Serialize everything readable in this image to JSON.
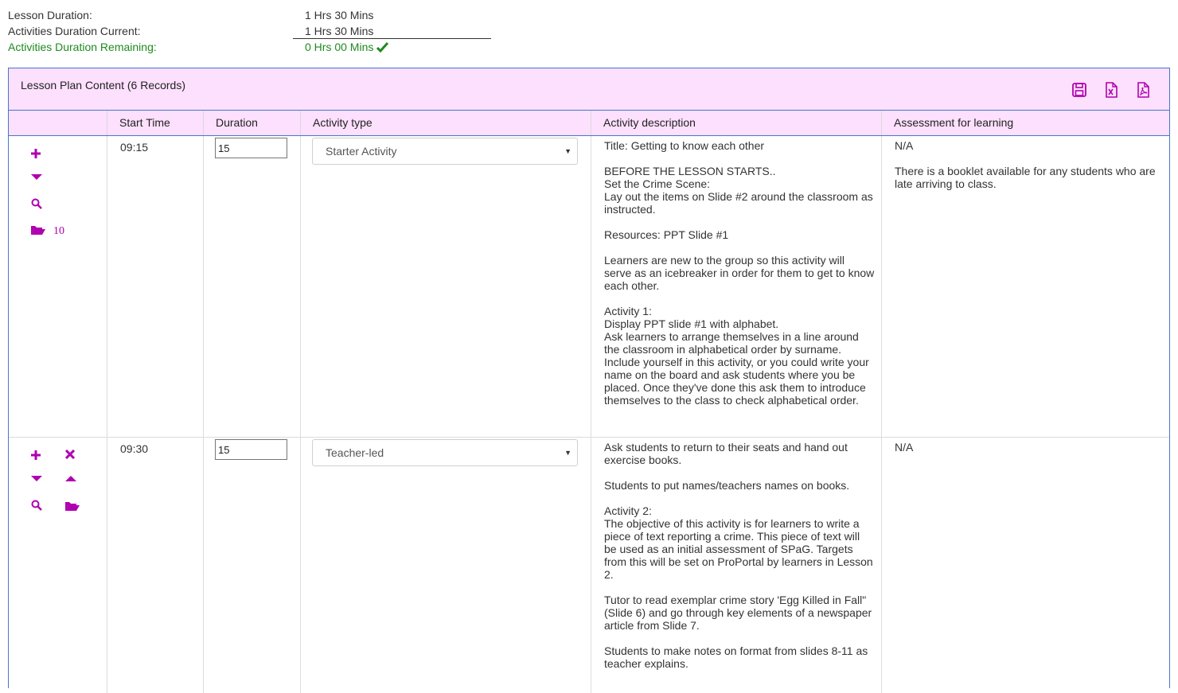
{
  "summary": {
    "lesson_duration_label": "Lesson Duration:",
    "lesson_duration_value": "1 Hrs 30 Mins",
    "current_label": "Activities Duration Current:",
    "current_value": "1 Hrs 30 Mins",
    "remaining_label": "Activities Duration Remaining:",
    "remaining_value": "0 Hrs 00 Mins"
  },
  "panel": {
    "title": "Lesson Plan Content (6 Records)"
  },
  "columns": [
    "Start Time",
    "Duration",
    "Activity type",
    "Activity description",
    "Assessment for learning"
  ],
  "rows": [
    {
      "start_time": "09:15",
      "duration": "15",
      "activity_type": "Starter Activity",
      "resource_count": "10",
      "description": "Title: Getting to know each other\n\nBEFORE THE LESSON STARTS..\nSet the Crime Scene:\nLay out the items on Slide #2 around the classroom as instructed.\n\nResources: PPT Slide #1\n\nLearners are new to the group so this activity will serve as an icebreaker in order for them to get to know each other.\n\nActivity 1:\nDisplay PPT slide #1 with alphabet.\nAsk learners to arrange themselves in a line around the classroom in alphabetical order by surname. Include yourself in this activity, or you could write your name on the board and ask students where you be placed. Once they've done this ask them to introduce themselves to the class to check alphabetical order.",
      "assessment": "N/A\n\nThere is a booklet available for any students who are late arriving to class."
    },
    {
      "start_time": "09:30",
      "duration": "15",
      "activity_type": "Teacher-led",
      "description": "Ask students to return to their seats and hand out exercise books.\n\nStudents to put names/teachers names on books.\n\nActivity 2:\nThe objective of this activity is for learners to write a piece of text reporting a crime.  This piece of text will be used as an initial assessment of SPaG. Targets from this will be set on ProPortal by learners in Lesson 2.\n\nTutor to read exemplar crime story 'Egg Killed in Fall\" (Slide 6) and go through key elements of a newspaper article from Slide 7.\n\nStudents to make notes on format from slides 8-11 as teacher explains.",
      "assessment": "N/A"
    }
  ],
  "colors": {
    "accent": "#b000b0",
    "header_bg": "#fde0fd",
    "border": "#4a74c9",
    "success": "#1e8a1e"
  },
  "icons": [
    "save-icon",
    "excel-export-icon",
    "pdf-export-icon",
    "plus-icon",
    "caret-down-icon",
    "caret-up-icon",
    "search-icon",
    "folder-open-icon",
    "close-icon",
    "check-icon"
  ]
}
